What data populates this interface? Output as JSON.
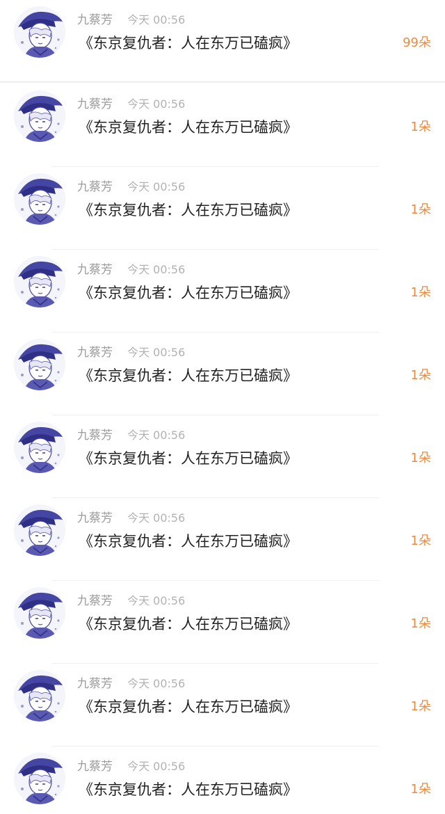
{
  "records": [
    {
      "username": "九蔡芳",
      "time": "今天 00:56",
      "book_title": "《东京复仇者：人在东万已磕疯》",
      "count": "99朵",
      "avatar_icon": "anime-avatar-icon"
    },
    {
      "username": "九蔡芳",
      "time": "今天 00:56",
      "book_title": "《东京复仇者：人在东万已磕疯》",
      "count": "1朵",
      "avatar_icon": "anime-avatar-icon"
    },
    {
      "username": "九蔡芳",
      "time": "今天 00:56",
      "book_title": "《东京复仇者：人在东万已磕疯》",
      "count": "1朵",
      "avatar_icon": "anime-avatar-icon"
    },
    {
      "username": "九蔡芳",
      "time": "今天 00:56",
      "book_title": "《东京复仇者：人在东万已磕疯》",
      "count": "1朵",
      "avatar_icon": "anime-avatar-icon"
    },
    {
      "username": "九蔡芳",
      "time": "今天 00:56",
      "book_title": "《东京复仇者：人在东万已磕疯》",
      "count": "1朵",
      "avatar_icon": "anime-avatar-icon"
    },
    {
      "username": "九蔡芳",
      "time": "今天 00:56",
      "book_title": "《东京复仇者：人在东万已磕疯》",
      "count": "1朵",
      "avatar_icon": "anime-avatar-icon"
    },
    {
      "username": "九蔡芳",
      "time": "今天 00:56",
      "book_title": "《东京复仇者：人在东万已磕疯》",
      "count": "1朵",
      "avatar_icon": "anime-avatar-icon"
    },
    {
      "username": "九蔡芳",
      "time": "今天 00:56",
      "book_title": "《东京复仇者：人在东万已磕疯》",
      "count": "1朵",
      "avatar_icon": "anime-avatar-icon"
    },
    {
      "username": "九蔡芳",
      "time": "今天 00:56",
      "book_title": "《东京复仇者：人在东万已磕疯》",
      "count": "1朵",
      "avatar_icon": "anime-avatar-icon"
    },
    {
      "username": "九蔡芳",
      "time": "今天 00:56",
      "book_title": "《东京复仇者：人在东万已磕疯》",
      "count": "1朵",
      "avatar_icon": "anime-avatar-icon"
    }
  ],
  "colors": {
    "username": "#9c9c9c",
    "time": "#b2b2b2",
    "title": "#222222",
    "count_accent": "#ee8a3c",
    "avatar_ink": "#3f3f9e"
  }
}
